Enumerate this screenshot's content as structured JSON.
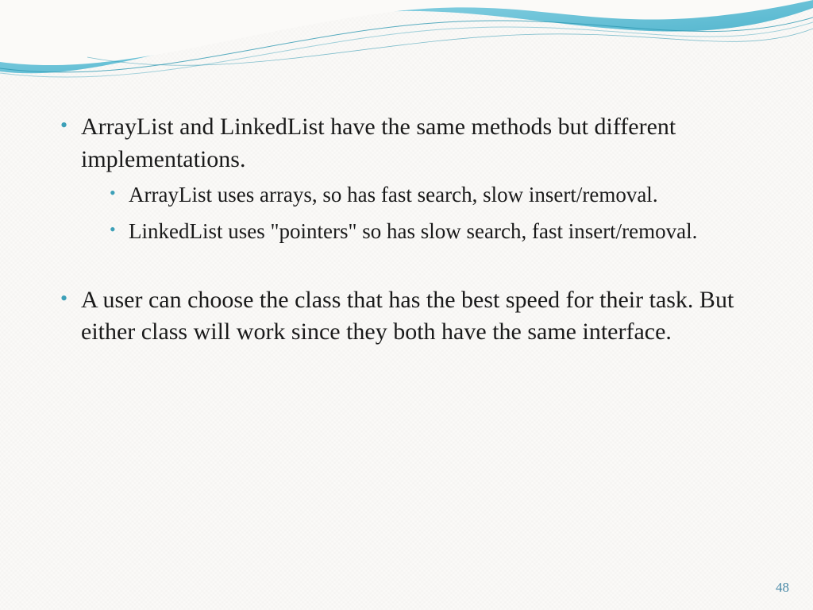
{
  "bullets": {
    "b1": "ArrayList and LinkedList have the same methods but different implementations.",
    "b1_sub1": "ArrayList uses arrays, so has fast search, slow insert/removal.",
    "b1_sub2": "LinkedList uses \"pointers\" so has slow search, fast insert/removal.",
    "b2": "A user can choose the class that has the best speed for their task. But either class will work since they both have the same interface."
  },
  "page_number": "48"
}
